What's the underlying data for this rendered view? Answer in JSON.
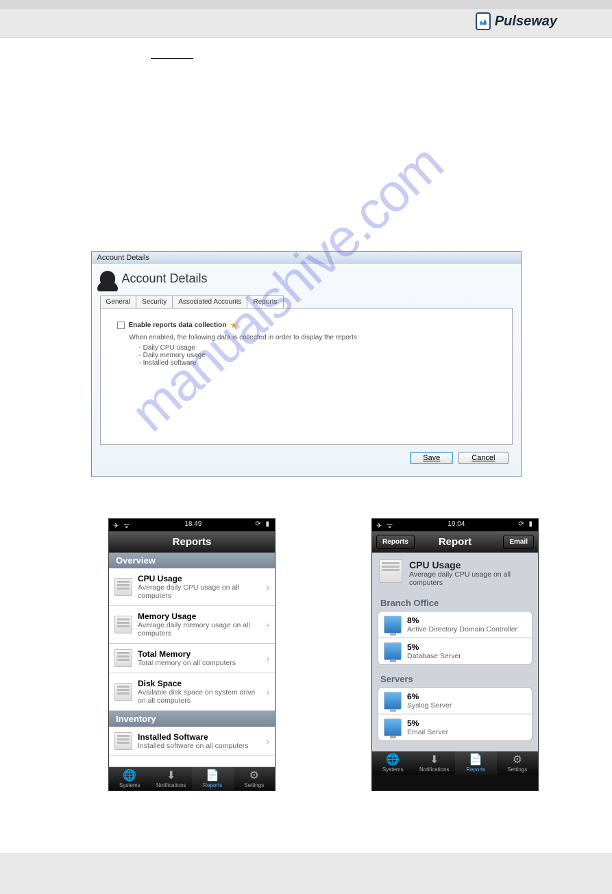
{
  "logo_text": "Pulseway",
  "watermark": "manualshive.com",
  "window": {
    "title": "Account Details",
    "heading": "Account Details",
    "tabs": [
      "General",
      "Security",
      "Associated Accounts",
      "Reports"
    ],
    "active_tab": 3,
    "checkbox_label": "Enable reports data collection",
    "description": "When enabled, the following data is collected in order to display the reports:",
    "items": [
      "Daily CPU usage",
      "Daily memory usage",
      "Installed software"
    ],
    "save_label": "Save",
    "cancel_label": "Cancel"
  },
  "phone1": {
    "time": "18:49",
    "nav_title": "Reports",
    "sections": [
      {
        "header": "Overview",
        "rows": [
          {
            "title": "CPU Usage",
            "sub": "Average daily CPU usage on all computers"
          },
          {
            "title": "Memory Usage",
            "sub": "Average daily memory usage on all computers"
          },
          {
            "title": "Total Memory",
            "sub": "Total memory on all computers"
          },
          {
            "title": "Disk Space",
            "sub": "Available disk space on system drive on all computers"
          }
        ]
      },
      {
        "header": "Inventory",
        "rows": [
          {
            "title": "Installed Software",
            "sub": "Installed software on all computers"
          }
        ]
      }
    ]
  },
  "phone2": {
    "time": "19:04",
    "nav_title": "Report",
    "back_label": "Reports",
    "right_label": "Email",
    "head_title": "CPU Usage",
    "head_sub": "Average daily CPU usage on all computers",
    "sections": [
      {
        "header": "Branch Office",
        "rows": [
          {
            "title": "8%",
            "sub": "Active Directory Domain Controller"
          },
          {
            "title": "5%",
            "sub": "Database Server"
          }
        ]
      },
      {
        "header": "Servers",
        "rows": [
          {
            "title": "6%",
            "sub": "Syslog Server"
          },
          {
            "title": "5%",
            "sub": "Email Server"
          }
        ]
      }
    ]
  },
  "tabbar": [
    {
      "icon": "🌐",
      "label": "Systems"
    },
    {
      "icon": "⬇",
      "label": "Notifications"
    },
    {
      "icon": "📄",
      "label": "Reports"
    },
    {
      "icon": "⚙",
      "label": "Settings"
    }
  ],
  "tabbar_active": 2
}
